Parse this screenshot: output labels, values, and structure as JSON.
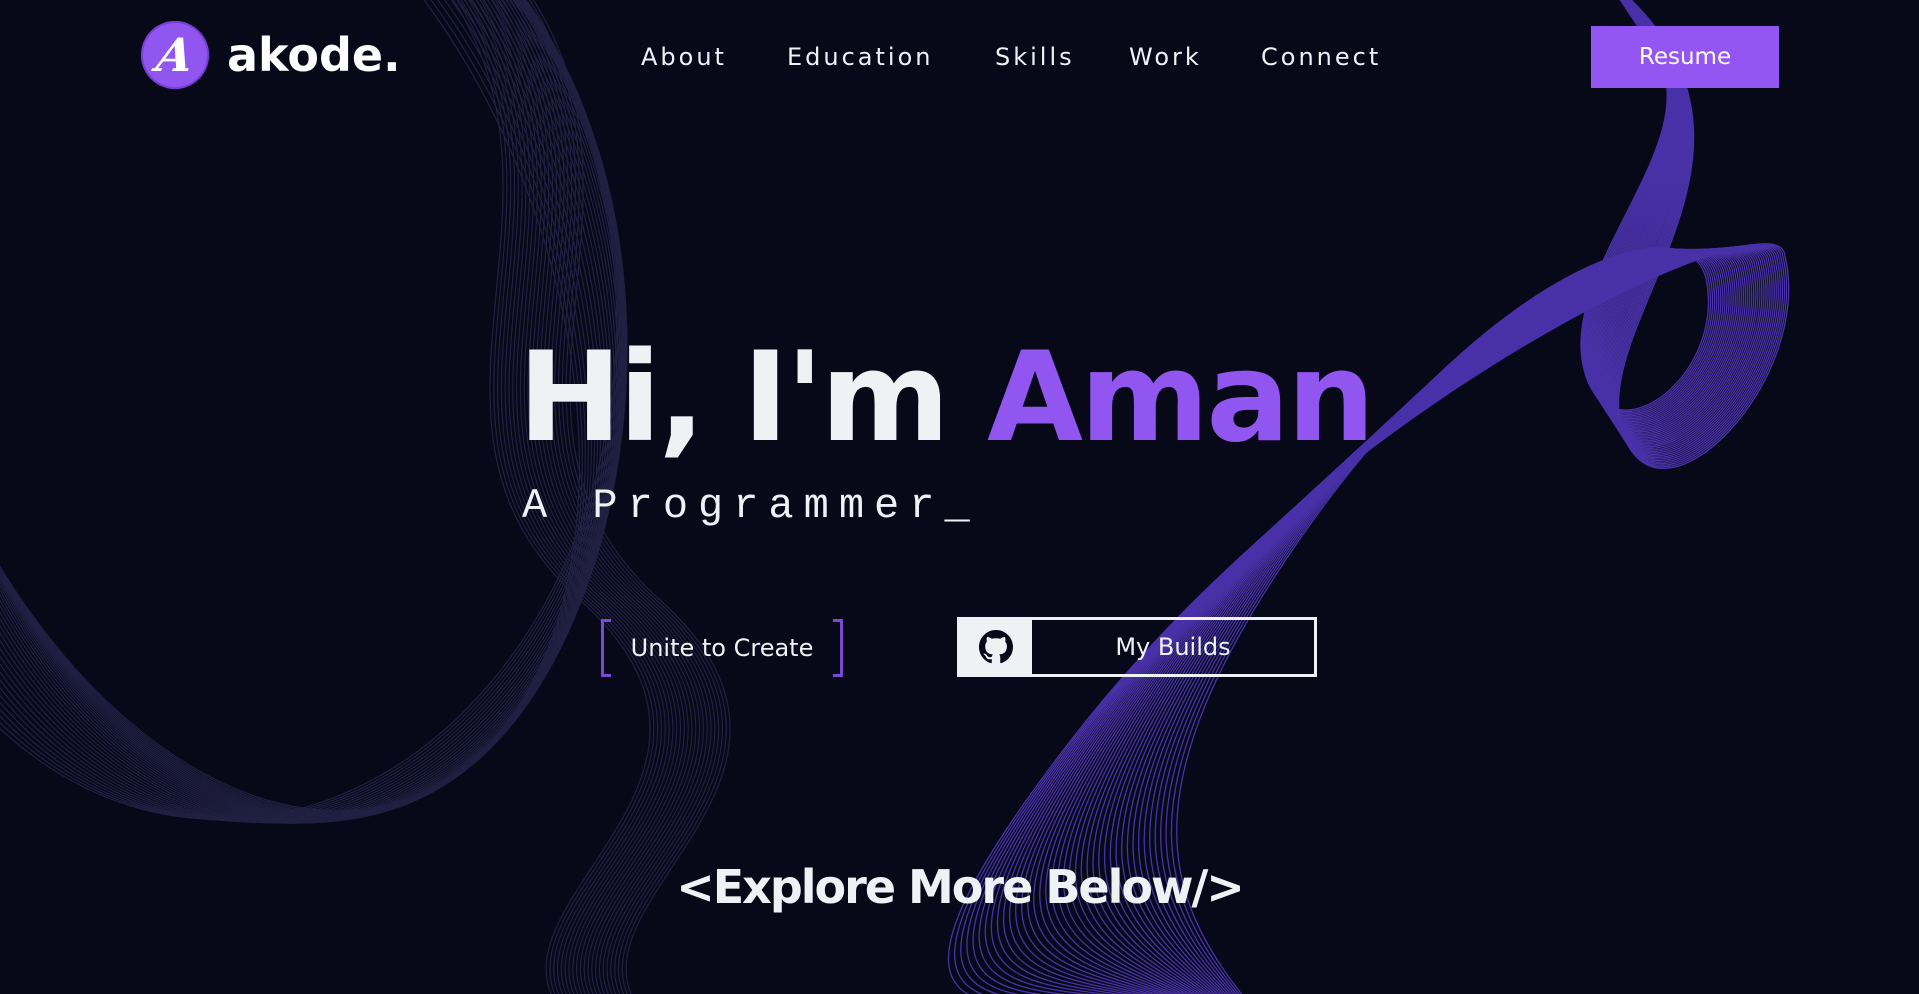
{
  "brand": {
    "logo_letter": "A",
    "name": "akode."
  },
  "nav": {
    "items": [
      "About",
      "Education",
      "Skills",
      "Work",
      "Connect"
    ],
    "resume_label": "Resume"
  },
  "hero": {
    "greeting": "Hi, I'm",
    "name": "Aman",
    "role": "A Programmer_"
  },
  "actions": {
    "unite_label": "Unite to Create",
    "builds_label": "My Builds",
    "builds_icon": "github-icon"
  },
  "footer_hint": {
    "text": "<Explore More Below/>"
  },
  "colors": {
    "background": "#070919",
    "accent": "#9155f0",
    "text": "#eef2f5"
  }
}
